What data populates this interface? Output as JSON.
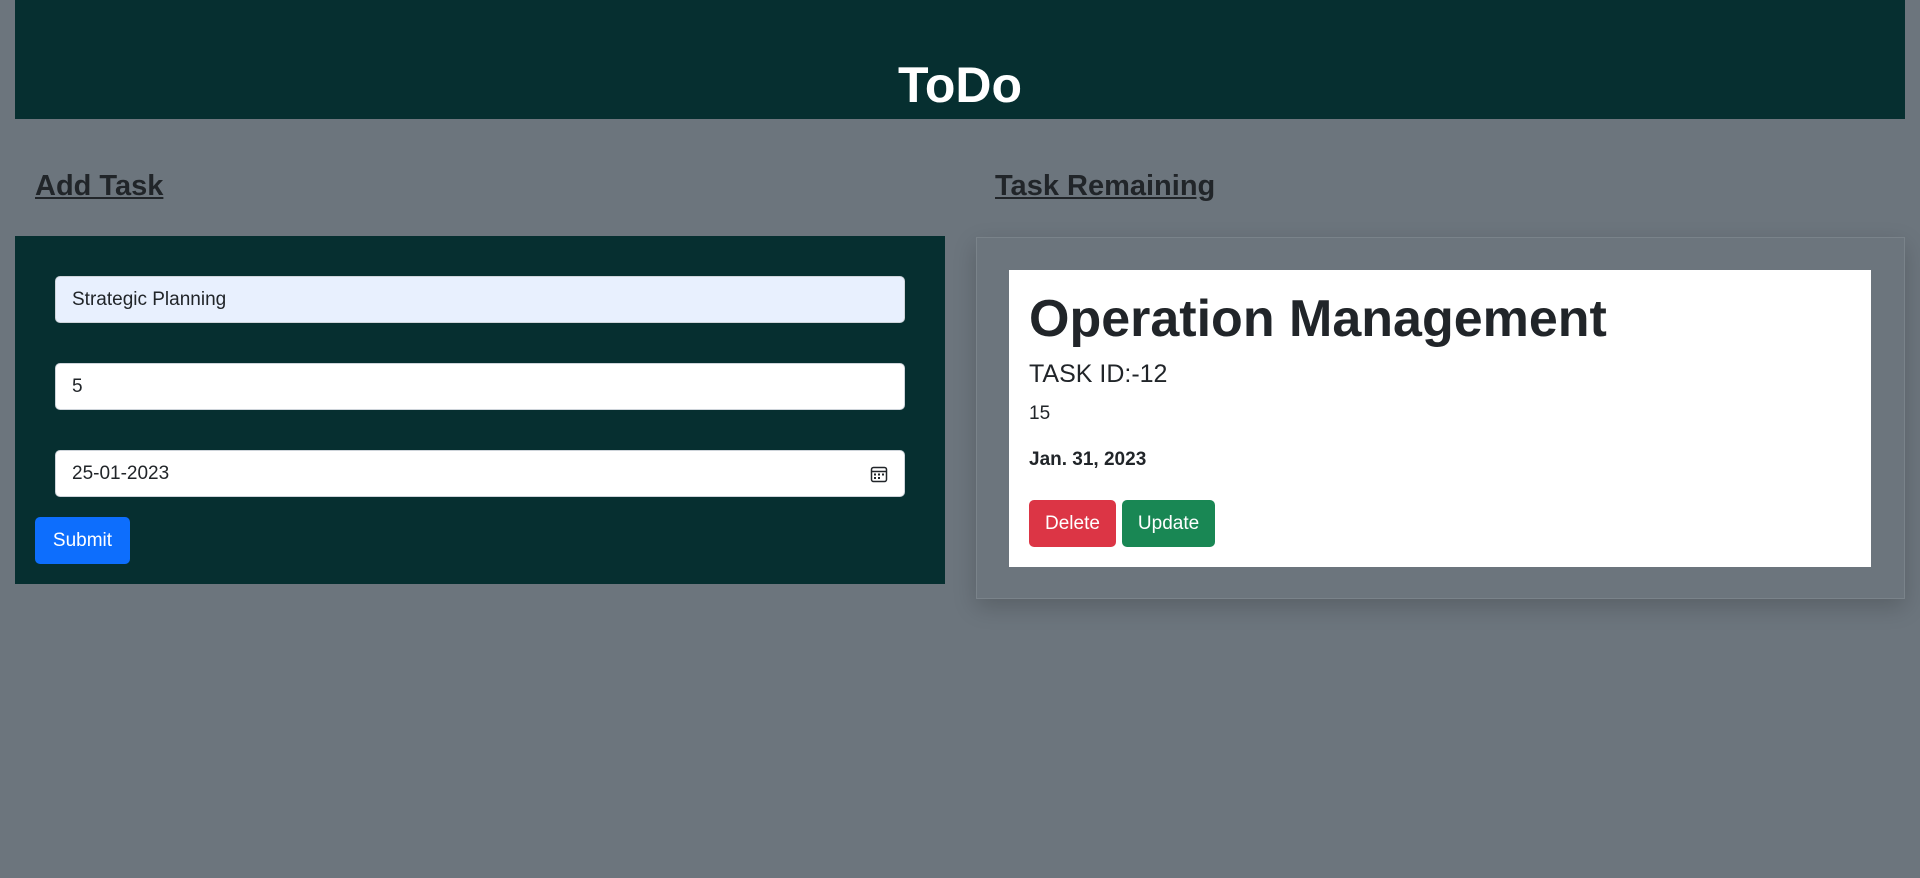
{
  "header": {
    "title": "ToDo"
  },
  "add_task": {
    "heading": "Add Task",
    "task_name": {
      "value": "Strategic Planning"
    },
    "task_number": {
      "value": "5"
    },
    "due_date": {
      "value": "25-01-2023"
    },
    "submit_label": "Submit"
  },
  "task_remaining": {
    "heading": "Task Remaining",
    "tasks": [
      {
        "title": "Operation Management",
        "task_id": "TASK ID:-12",
        "number": "15",
        "date": "Jan. 31, 2023",
        "delete_label": "Delete",
        "update_label": "Update"
      }
    ]
  },
  "colors": {
    "background": "#6c757d",
    "header": "#062f30",
    "primary": "#0d6efd",
    "danger": "#dc3545",
    "success": "#198754"
  },
  "icons": {
    "date_picker": "calendar-icon"
  }
}
